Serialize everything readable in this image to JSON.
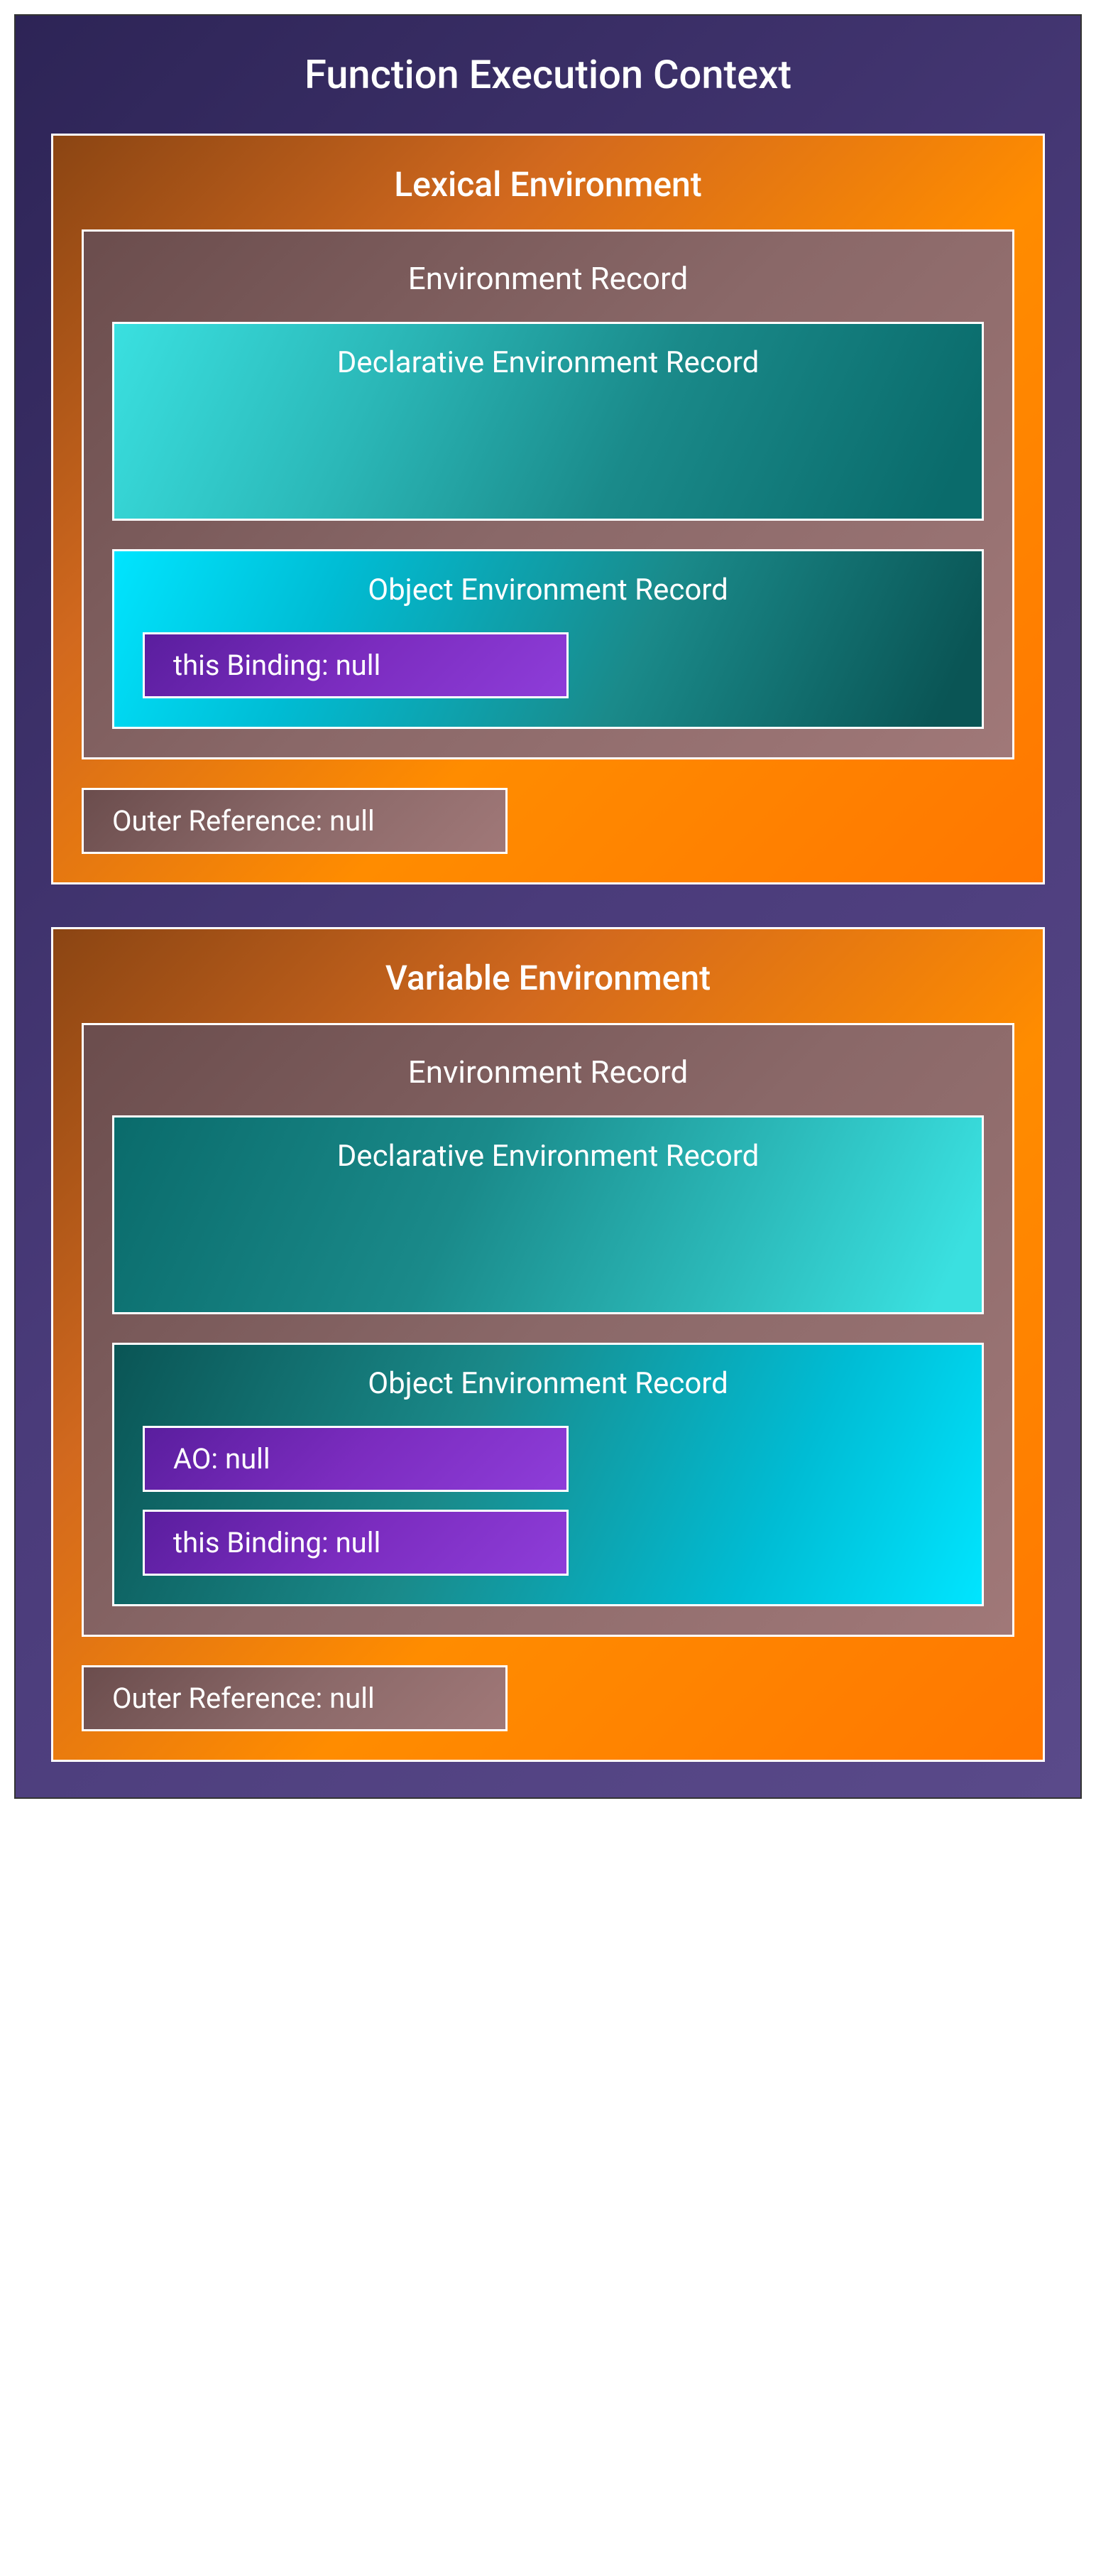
{
  "contextTitle": "Function Execution Context",
  "lexical": {
    "title": "Lexical Environment",
    "recordTitle": "Environment Record",
    "declarativeTitle": "Declarative Environment Record",
    "objectTitle": "Object Environment Record",
    "thisBinding": "this Binding: null",
    "outerReference": "Outer Reference: null"
  },
  "variable": {
    "title": "Variable Environment",
    "recordTitle": "Environment Record",
    "declarativeTitle": "Declarative Environment Record",
    "objectTitle": "Object Environment Record",
    "aoBinding": "AO: null",
    "thisBinding": "this Binding: null",
    "outerReference": "Outer Reference: null"
  }
}
